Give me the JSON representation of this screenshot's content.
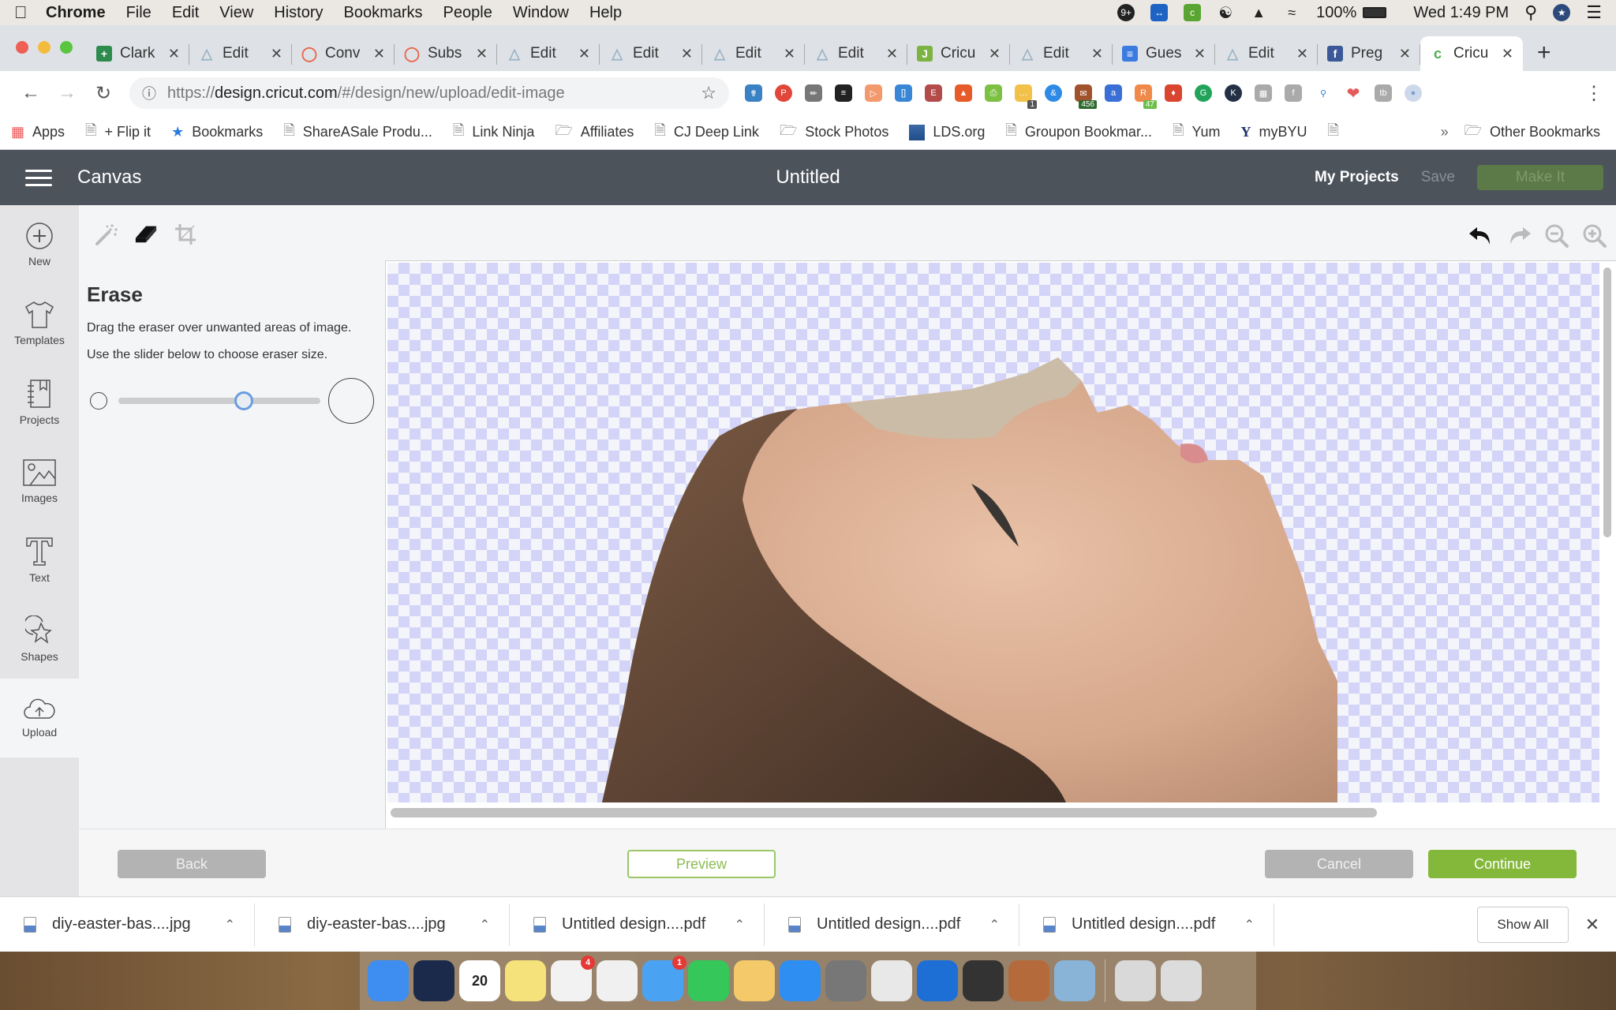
{
  "menubar": {
    "app": "Chrome",
    "items": [
      "File",
      "Edit",
      "View",
      "History",
      "Bookmarks",
      "People",
      "Window",
      "Help"
    ],
    "battery": "100%",
    "clock": "Wed 1:49 PM",
    "tray_icons": [
      "notification-9plus-icon",
      "teamviewer-icon",
      "cricut-icon",
      "creative-cloud-icon",
      "airplay-icon",
      "wifi-icon"
    ]
  },
  "tabs": [
    {
      "label": "Clark",
      "icon": "sheets-icon",
      "color": "#2e8b4e"
    },
    {
      "label": "Edit",
      "icon": "edit-icon",
      "color": "#9ab4c6"
    },
    {
      "label": "Conv",
      "icon": "circle-logo-icon",
      "color": "#e8664a"
    },
    {
      "label": "Subs",
      "icon": "circle-logo-icon",
      "color": "#e8664a"
    },
    {
      "label": "Edit",
      "icon": "edit-icon",
      "color": "#9ab4c6"
    },
    {
      "label": "Edit",
      "icon": "edit-icon",
      "color": "#9ab4c6"
    },
    {
      "label": "Edit",
      "icon": "edit-icon",
      "color": "#9ab4c6"
    },
    {
      "label": "Edit",
      "icon": "edit-icon",
      "color": "#9ab4c6"
    },
    {
      "label": "Cricu",
      "icon": "j-logo-icon",
      "color": "#7cb342"
    },
    {
      "label": "Edit",
      "icon": "edit-icon",
      "color": "#9ab4c6"
    },
    {
      "label": "Gues",
      "icon": "docs-icon",
      "color": "#3b7be0"
    },
    {
      "label": "Edit",
      "icon": "edit-icon",
      "color": "#9ab4c6"
    },
    {
      "label": "Preg",
      "icon": "facebook-icon",
      "color": "#3b5998"
    },
    {
      "label": "Cricu",
      "icon": "cricut-icon",
      "color": "#4caf50",
      "active": true
    }
  ],
  "toolbar": {
    "url_prefix": "https://",
    "url_host": "design.cricut.com",
    "url_path": "/#/design/new/upload/edit-image",
    "extension_badges": {
      "ext1": "1",
      "ext2": "456",
      "ext3": "47"
    }
  },
  "bookmarks": [
    {
      "label": "Apps",
      "icon": "apps-grid-icon"
    },
    {
      "label": "+ Flip it",
      "icon": "page-icon"
    },
    {
      "label": "Bookmarks",
      "icon": "star-icon"
    },
    {
      "label": "ShareASale Produ...",
      "icon": "page-icon"
    },
    {
      "label": "Link Ninja",
      "icon": "page-icon"
    },
    {
      "label": "Affiliates",
      "icon": "folder-icon"
    },
    {
      "label": "CJ Deep Link",
      "icon": "page-icon"
    },
    {
      "label": "Stock Photos",
      "icon": "folder-icon"
    },
    {
      "label": "LDS.org",
      "icon": "lds-icon"
    },
    {
      "label": "Groupon Bookmar...",
      "icon": "page-icon"
    },
    {
      "label": "Yum",
      "icon": "page-icon"
    },
    {
      "label": "myBYU",
      "icon": "byu-icon"
    },
    {
      "label": "",
      "icon": "page-icon"
    }
  ],
  "bookmarks_overflow": "»",
  "other_bookmarks": "Other Bookmarks",
  "app": {
    "name": "Canvas",
    "doc_title": "Untitled",
    "my_projects": "My Projects",
    "save": "Save",
    "make_it": "Make It"
  },
  "leftnav": [
    {
      "label": "New",
      "icon": "plus-circle-icon"
    },
    {
      "label": "Templates",
      "icon": "tshirt-icon"
    },
    {
      "label": "Projects",
      "icon": "notebook-icon"
    },
    {
      "label": "Images",
      "icon": "image-icon"
    },
    {
      "label": "Text",
      "icon": "text-t-icon"
    },
    {
      "label": "Shapes",
      "icon": "shapes-icon"
    },
    {
      "label": "Upload",
      "icon": "cloud-upload-icon",
      "active": true
    }
  ],
  "tools": {
    "active": "erase",
    "items": [
      "magic-wand",
      "eraser",
      "crop"
    ]
  },
  "panel": {
    "title": "Erase",
    "instruction1": "Drag the eraser over unwanted areas of image.",
    "instruction2": "Use the slider below to choose eraser size.",
    "eraser_size_fraction": 0.62
  },
  "footer": {
    "back": "Back",
    "preview": "Preview",
    "cancel": "Cancel",
    "continue": "Continue"
  },
  "downloads": [
    {
      "name": "diy-easter-bas....jpg"
    },
    {
      "name": "diy-easter-bas....jpg"
    },
    {
      "name": "Untitled design....pdf"
    },
    {
      "name": "Untitled design....pdf"
    },
    {
      "name": "Untitled design....pdf"
    }
  ],
  "downloads_show_all": "Show All",
  "dock": {
    "apps": [
      {
        "name": "finder",
        "color": "#3d8ef0"
      },
      {
        "name": "siri",
        "color": "#1b2a4a"
      },
      {
        "name": "calendar",
        "color": "#ffffff",
        "text": "20"
      },
      {
        "name": "notes",
        "color": "#f5e27a"
      },
      {
        "name": "reminders",
        "color": "#f2f2f2",
        "badge": "4"
      },
      {
        "name": "photos",
        "color": "#f0f0f0"
      },
      {
        "name": "messages",
        "color": "#4aa3f2",
        "badge": "1"
      },
      {
        "name": "facetime",
        "color": "#35c759"
      },
      {
        "name": "preview",
        "color": "#f3c96a"
      },
      {
        "name": "app-store",
        "color": "#2f8ef2"
      },
      {
        "name": "calculator",
        "color": "#777777"
      },
      {
        "name": "chrome",
        "color": "#e8e8e8"
      },
      {
        "name": "teamviewer",
        "color": "#1d6fd6"
      },
      {
        "name": "printer",
        "color": "#333333"
      },
      {
        "name": "dropper-app",
        "color": "#b56a3c"
      },
      {
        "name": "image-capture",
        "color": "#8ab3d8"
      },
      {
        "name": "downloads-stack",
        "color": "#d9d9d9"
      },
      {
        "name": "trash",
        "color": "#dcdcdc"
      }
    ]
  }
}
